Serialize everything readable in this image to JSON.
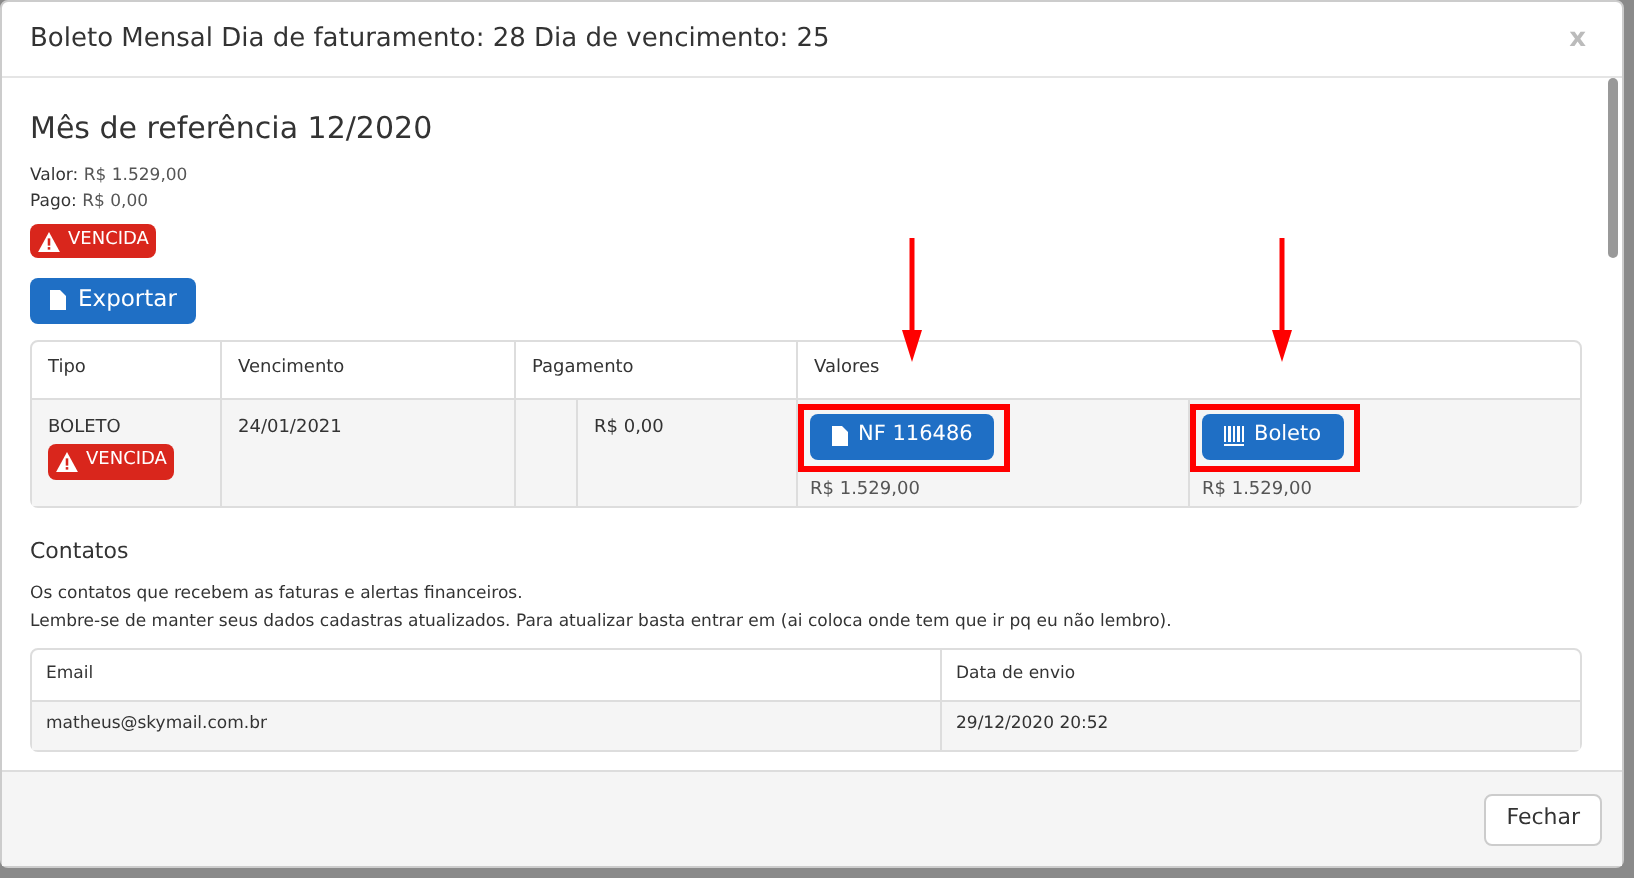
{
  "modal": {
    "title": "Boleto Mensal Dia de faturamento: 28 Dia de vencimento: 25",
    "close": "x"
  },
  "reference": {
    "heading": "Mês de referência 12/2020",
    "summary": [
      {
        "label": "Valor:",
        "value": "R$ 1.529,00"
      },
      {
        "label": "Pago:",
        "value": "R$ 0,00"
      }
    ],
    "status_badge": "VENCIDA",
    "export_button": "Exportar"
  },
  "invoices": {
    "columns": [
      "Tipo",
      "Vencimento",
      "Pagamento",
      "Valores"
    ],
    "rows": [
      {
        "type": "BOLETO",
        "badge": "VENCIDA",
        "due": "24/01/2021",
        "payment": "R$ 0,00",
        "values": [
          {
            "kind": "document",
            "button": "NF 116486",
            "amount": "R$ 1.529,00"
          },
          {
            "kind": "barcode",
            "button": "Boleto",
            "amount": "R$ 1.529,00"
          }
        ]
      }
    ]
  },
  "contacts": {
    "heading": "Contatos",
    "lines": [
      "Os contatos que recebem as faturas e alertas financeiros.",
      "Lembre-se de manter seus dados cadastras atualizados. Para atualizar basta entrar em (ai coloca onde tem que ir pq eu não lembro)."
    ],
    "columns": [
      "Email",
      "Data de envio"
    ],
    "rows": [
      {
        "email": "matheus@skymail.com.br",
        "sent": "29/12/2020 20:52"
      }
    ]
  },
  "footer": {
    "close_button": "Fechar"
  }
}
